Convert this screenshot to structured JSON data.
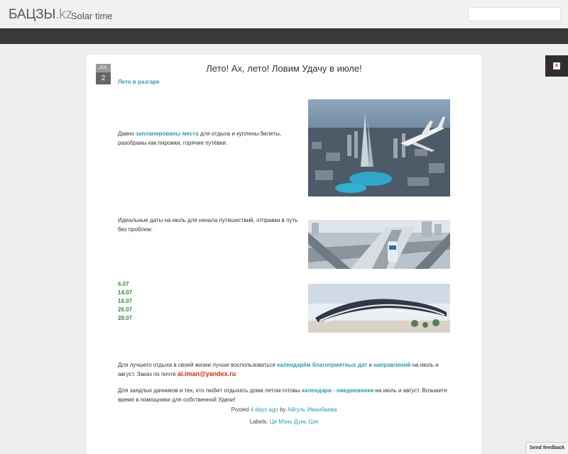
{
  "header": {
    "brand_main": "БАЦЗЫ",
    "brand_tld": ".kz",
    "tagline": "Solar time"
  },
  "post": {
    "date_month": "JUL",
    "date_day": "2",
    "title": "Лето! Ах, лето! Ловим Удачу в июле!",
    "subtitle": "Лето в разгаре",
    "p1": {
      "before": "Давно ",
      "link": "запланированы места",
      "after": "  для отдыха и куплены билеты, разобраны как пирожки, горячие путёвки."
    },
    "p2": "Идеальные даты на июль для начала путешествий, отправки в путь без проблем:",
    "dates": [
      "6.07",
      "14.07",
      "16.07",
      "26.07",
      "28.07"
    ],
    "p3": {
      "before": "Для лучшего отдыха в своей жизни лучше воспользоваться ",
      "link1": "календарём благоприятных дат",
      "mid": " и ",
      "link2": "направлений",
      "after": " на июль и август. Заказ по почте ",
      "email": "ai.iman@yandex.ru"
    },
    "p4": {
      "before": "Для заядлых дачников и тех, кто любит отдыхать дома летом готовы ",
      "link": "календари - ежедневники",
      "after": " на июль и август. Возьмите время в помощники для собственной Удачи!"
    },
    "posted_prefix": "Posted ",
    "posted_time": "4 days ago",
    "posted_by": " by ",
    "author": "Айгуль Иманбаева",
    "labels_prefix": "Labels: ",
    "label": "Ци Мэнь Дунь Цзя"
  },
  "feedback_label": "Send feedback",
  "colors": {
    "link": "#2a9bb5",
    "dates": "#3a8a3a",
    "email": "#dd2211",
    "navbar": "#393939"
  }
}
